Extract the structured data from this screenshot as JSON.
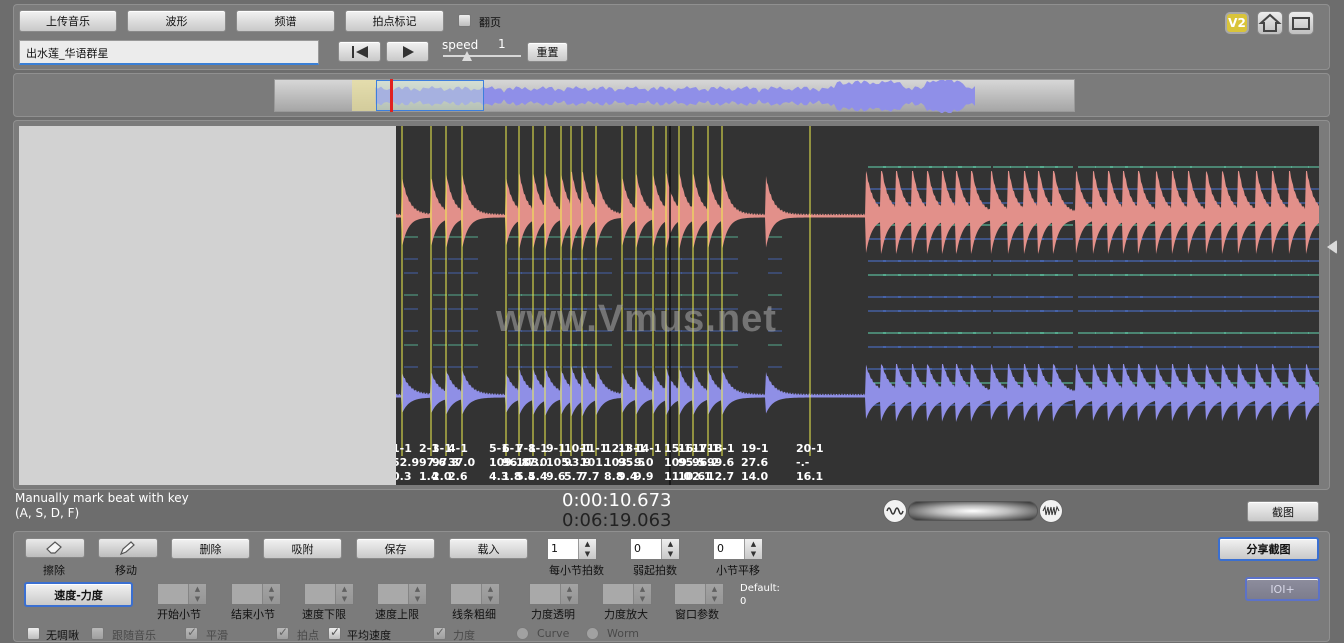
{
  "top_buttons": [
    "上传音乐",
    "波形",
    "频谱",
    "拍点标记"
  ],
  "page_flip_label": "翻页",
  "song_title": "出水莲_华语群星",
  "speed": {
    "label": "speed",
    "value": "1"
  },
  "reset_label": "重置",
  "badges": {
    "version": "V2"
  },
  "icons": [
    "skip-to-start-icon",
    "play-icon",
    "home-icon",
    "window-icon",
    "eraser-icon",
    "pencil-icon"
  ],
  "watermark": "www.Vmus.net",
  "colors": {
    "spectrogram_bg": "#333333",
    "marker": "#f1f14d",
    "envelope": "#e2908a",
    "bass": "#8f8fe6"
  },
  "markers": [
    {
      "label": "1-1",
      "tempo": "52.9",
      "dyn": "0.3"
    },
    {
      "label": "2-1",
      "tempo": "97.6",
      "dyn": "1.4"
    },
    {
      "label": "3-1",
      "tempo": "97.3",
      "dyn": "2.0"
    },
    {
      "label": "4-1",
      "tempo": "37.0",
      "dyn": "2.6"
    },
    {
      "label": "5-1",
      "tempo": "109.",
      "dyn": "4.3"
    },
    {
      "label": "6-1",
      "tempo": "96.8",
      "dyn": "1.8"
    },
    {
      "label": "7-1",
      "tempo": "103.",
      "dyn": "5.4"
    },
    {
      "label": "8-1",
      "tempo": "7.0",
      "dyn": "5.4"
    },
    {
      "label": "9-1",
      "tempo": "105.",
      "dyn": "9.6"
    },
    {
      "label": "10-1",
      "tempo": "93.9",
      "dyn": "5.7"
    },
    {
      "label": "11-1",
      "tempo": "101.",
      "dyn": "7.7"
    },
    {
      "label": "12-1",
      "tempo": "103.",
      "dyn": "8.8"
    },
    {
      "label": "13-1",
      "tempo": "95.5",
      "dyn": "9.4"
    },
    {
      "label": "14-1",
      "tempo": "9.0",
      "dyn": "9.9"
    },
    {
      "label": "15-1",
      "tempo": "109.",
      "dyn": "11.0"
    },
    {
      "label": "16-1",
      "tempo": "95.5",
      "dyn": "10.6"
    },
    {
      "label": "17-1",
      "tempo": "96.2",
      "dyn": "2.1"
    },
    {
      "label": "18-1",
      "tempo": "99.6",
      "dyn": "12.7"
    },
    {
      "label": "19-1",
      "tempo": "27.6",
      "dyn": "14.0"
    },
    {
      "label": "20-1",
      "tempo": "-.-",
      "dyn": "16.1"
    }
  ],
  "status": {
    "hint_line1": "Manually mark beat with key",
    "hint_line2": "(A, S, D, F)",
    "current_time": "0:00:10.673",
    "total_time": "0:06:19.063",
    "screenshot_label": "截图"
  },
  "tools": {
    "erase_label": "擦除",
    "move_label": "移动",
    "actions": [
      "删除",
      "吸附",
      "保存",
      "载入"
    ],
    "beats_per_bar": {
      "label": "每小节拍数",
      "value": "1"
    },
    "pickup_beats": {
      "label": "弱起拍数",
      "value": "0"
    },
    "bar_shift": {
      "label": "小节平移",
      "value": "0"
    },
    "share_label": "分享截图",
    "mode_label": "速度-力度",
    "params": [
      "开始小节",
      "结束小节",
      "速度下限",
      "速度上限",
      "线条粗细",
      "力度透明",
      "力度放大",
      "窗口参数"
    ],
    "default_label": "Default:",
    "default_value": "0",
    "ioi_label": "IOI+"
  },
  "options": [
    {
      "label": "无啁啾",
      "checked": false,
      "dim": false
    },
    {
      "label": "跟随音乐",
      "checked": false,
      "dim": true
    },
    {
      "label": "平滑",
      "checked": true,
      "dim": true
    },
    {
      "label": "拍点",
      "checked": true,
      "dim": true
    },
    {
      "label": "平均速度",
      "checked": true,
      "dim": false
    },
    {
      "label": "力度",
      "checked": true,
      "dim": true
    }
  ],
  "radios": [
    {
      "label": "Curve"
    },
    {
      "label": "Worm"
    }
  ]
}
